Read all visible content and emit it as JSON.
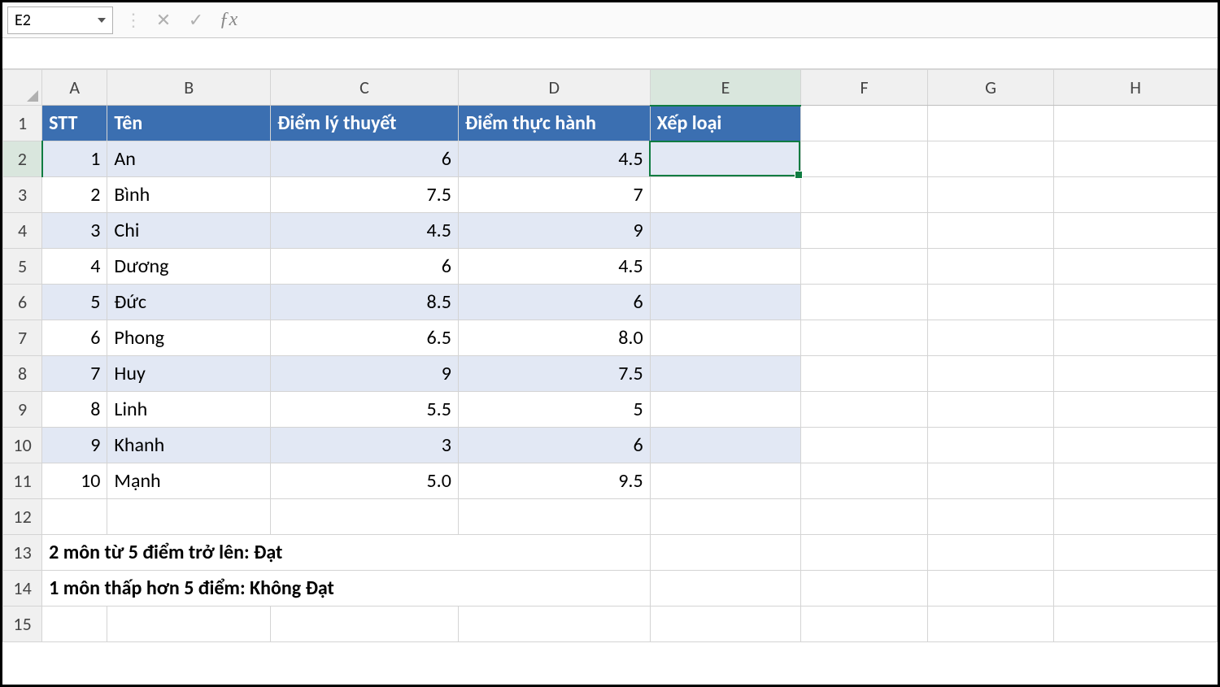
{
  "namebox": {
    "value": "E2"
  },
  "formula_bar": {
    "value": "",
    "cancel_title": "Cancel",
    "enter_title": "Enter",
    "fx_title": "Insert Function"
  },
  "columns": [
    "A",
    "B",
    "C",
    "D",
    "E",
    "F",
    "G",
    "H"
  ],
  "row_numbers": [
    "1",
    "2",
    "3",
    "4",
    "5",
    "6",
    "7",
    "8",
    "9",
    "10",
    "11",
    "12",
    "13",
    "14",
    "15"
  ],
  "selected_cell": "E2",
  "selected_col": "E",
  "selected_row": "2",
  "headers": {
    "stt": "STT",
    "ten": "Tên",
    "ly_thuyet": "Điểm lý thuyết",
    "thuc_hanh": "Điểm thực hành",
    "xep_loai": "Xếp loại"
  },
  "rows": [
    {
      "stt": "1",
      "ten": "An",
      "ly": "6",
      "th": "4.5",
      "xl": ""
    },
    {
      "stt": "2",
      "ten": "Bình",
      "ly": "7.5",
      "th": "7",
      "xl": ""
    },
    {
      "stt": "3",
      "ten": "Chi",
      "ly": "4.5",
      "th": "9",
      "xl": ""
    },
    {
      "stt": "4",
      "ten": "Dương",
      "ly": "6",
      "th": "4.5",
      "xl": ""
    },
    {
      "stt": "5",
      "ten": "Đức",
      "ly": "8.5",
      "th": "6",
      "xl": ""
    },
    {
      "stt": "6",
      "ten": "Phong",
      "ly": "6.5",
      "th": "8.0",
      "xl": ""
    },
    {
      "stt": "7",
      "ten": "Huy",
      "ly": "9",
      "th": "7.5",
      "xl": ""
    },
    {
      "stt": "8",
      "ten": "Linh",
      "ly": "5.5",
      "th": "5",
      "xl": ""
    },
    {
      "stt": "9",
      "ten": "Khanh",
      "ly": "3",
      "th": "6",
      "xl": ""
    },
    {
      "stt": "10",
      "ten": "Mạnh",
      "ly": "5.0",
      "th": "9.5",
      "xl": ""
    }
  ],
  "notes": {
    "line1": "2 môn từ 5 điểm trở lên: Đạt",
    "line2": "1 môn thấp hơn 5 điểm: Không Đạt"
  }
}
